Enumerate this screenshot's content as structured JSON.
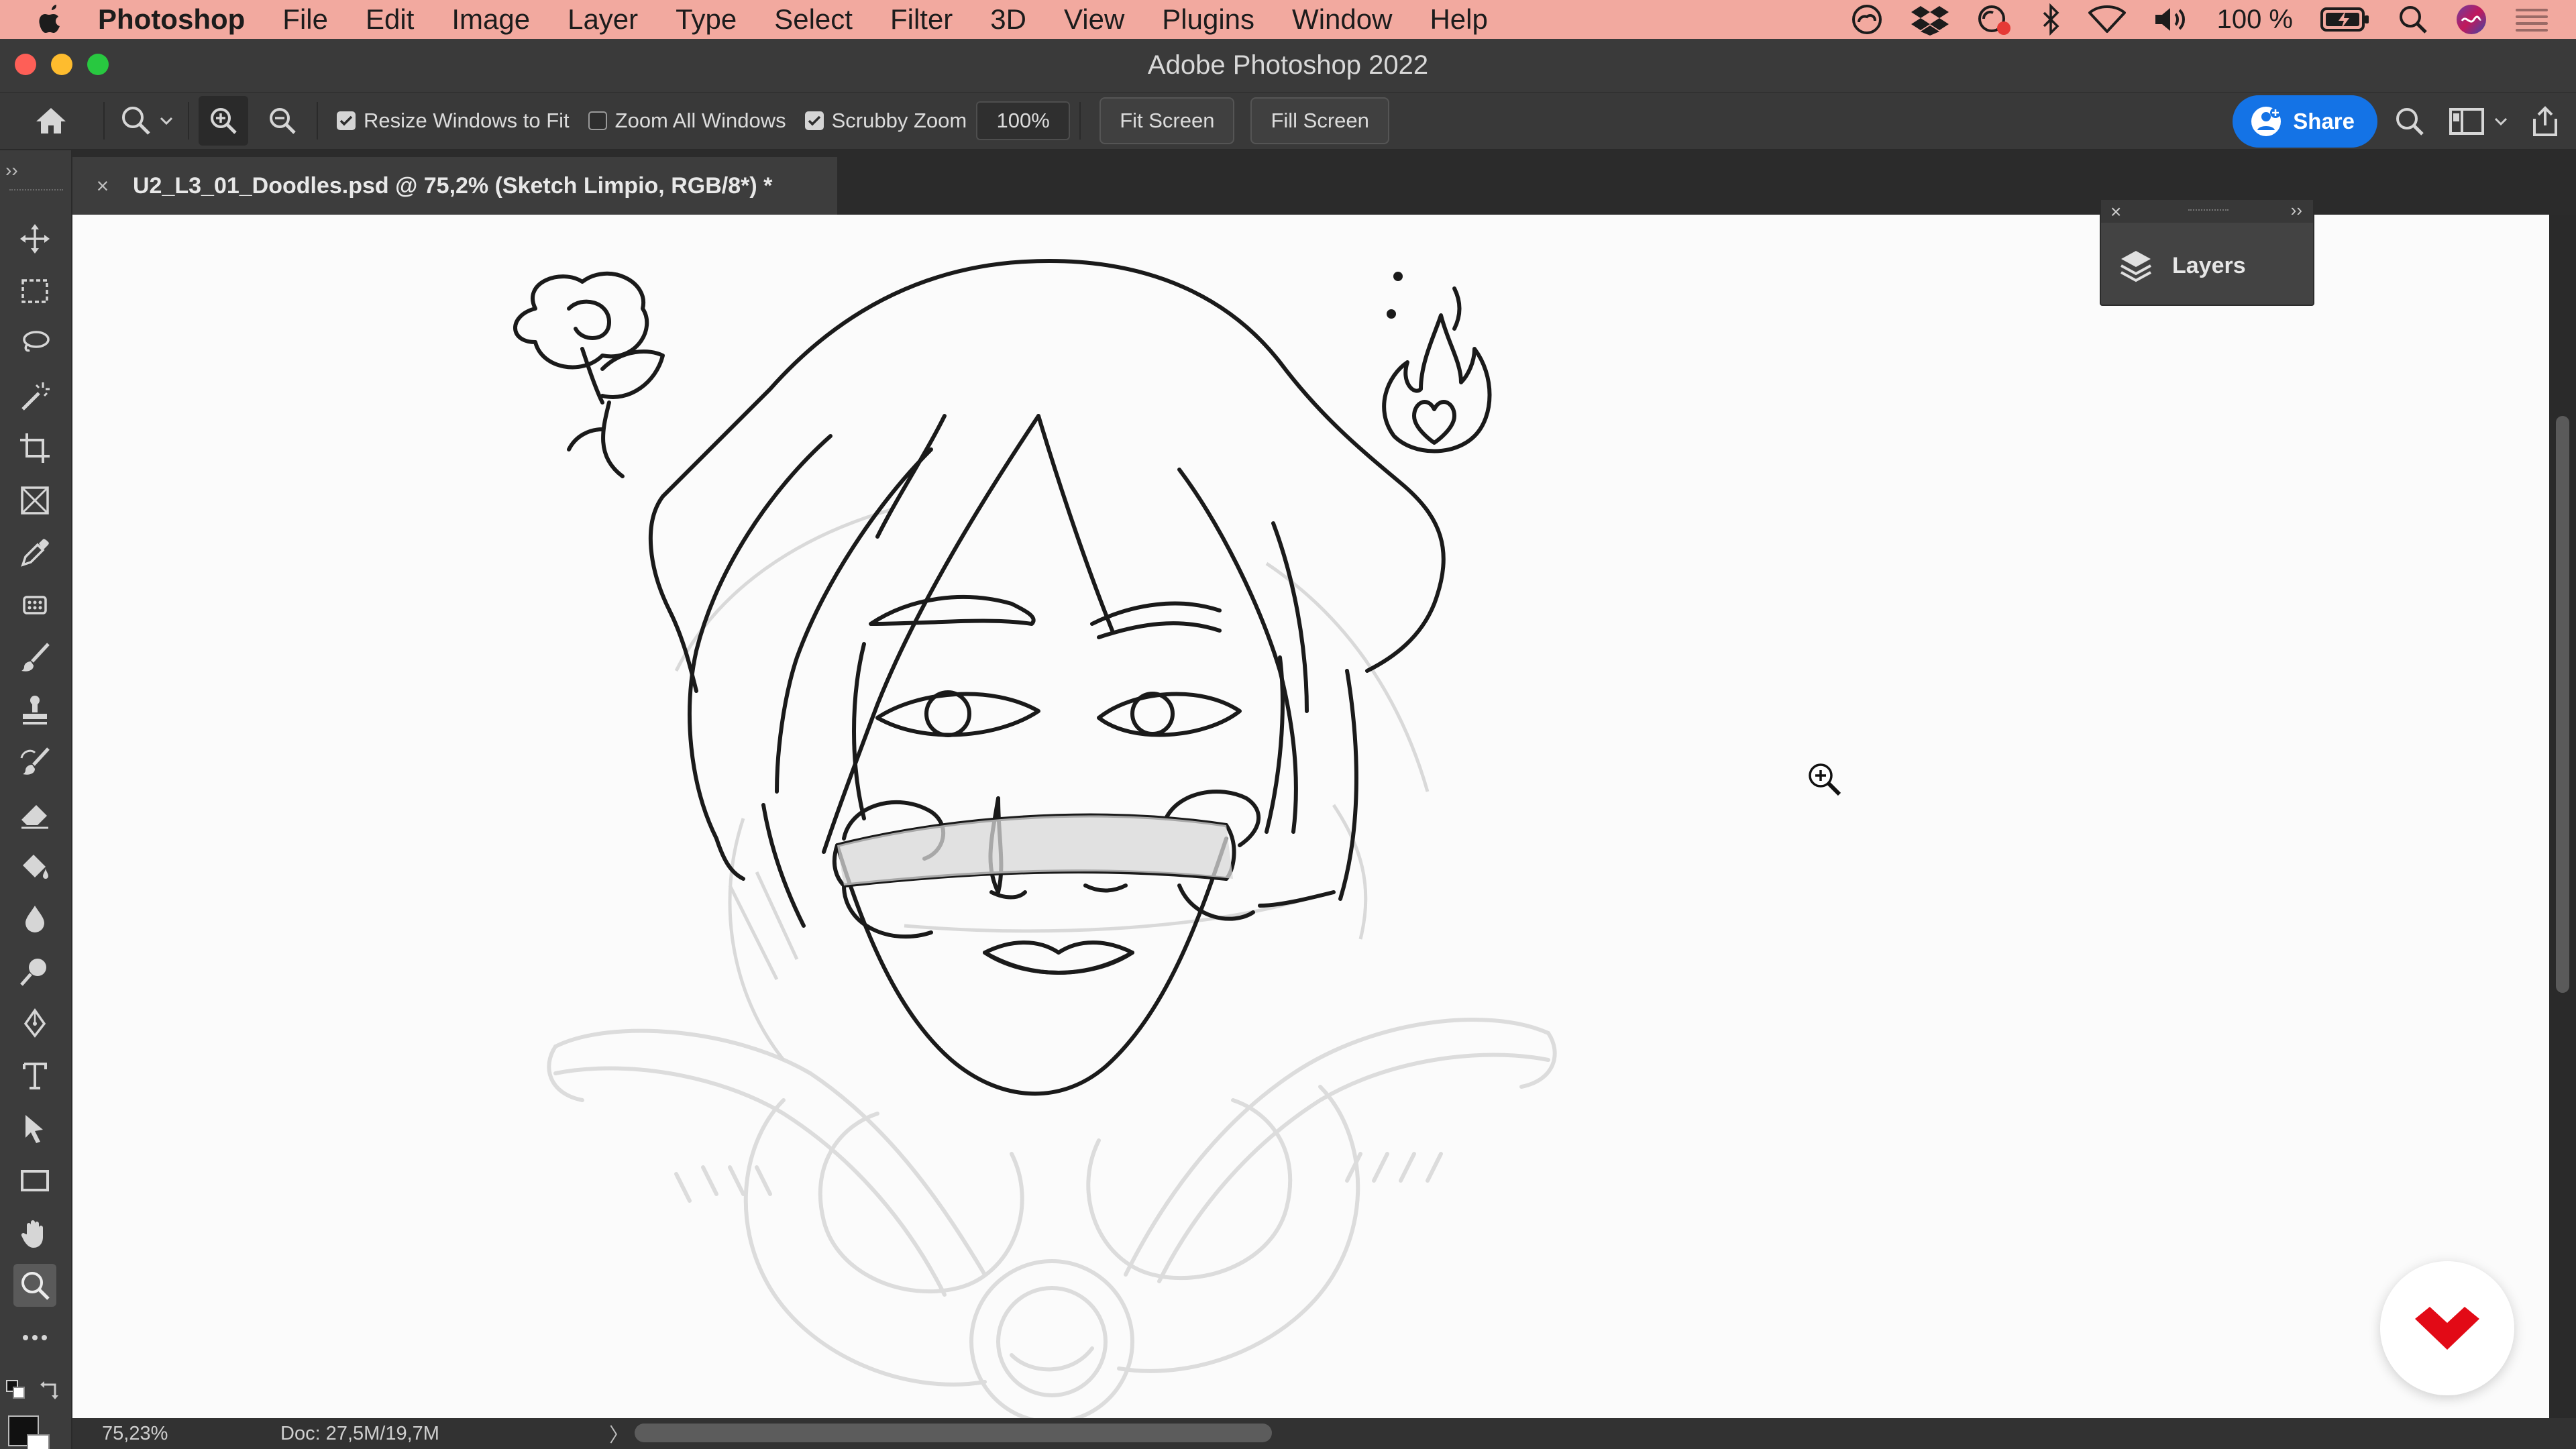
{
  "menubar": {
    "app_name": "Photoshop",
    "items": [
      "File",
      "Edit",
      "Image",
      "Layer",
      "Type",
      "Select",
      "Filter",
      "3D",
      "View",
      "Plugins",
      "Window",
      "Help"
    ],
    "battery": "100 %"
  },
  "window": {
    "title": "Adobe Photoshop 2022"
  },
  "options": {
    "resize_windows": {
      "label": "Resize Windows to Fit",
      "checked": true
    },
    "zoom_all": {
      "label": "Zoom All Windows",
      "checked": false
    },
    "scrubby_zoom": {
      "label": "Scrubby Zoom",
      "checked": true
    },
    "zoom_value": "100%",
    "fit_screen": "Fit Screen",
    "fill_screen": "Fill Screen",
    "share": "Share"
  },
  "document": {
    "tab_close": "×",
    "tab_label": "U2_L3_01_Doodles.psd @ 75,2% (Sketch Limpio, RGB/8*) *"
  },
  "panel": {
    "layers_label": "Layers",
    "close": "×",
    "expand": "››"
  },
  "statusbar": {
    "zoom": "75,23%",
    "doc_size": "Doc: 27,5M/19,7M",
    "arrow": "〉"
  },
  "tools": [
    "move",
    "marquee",
    "lasso",
    "magic-wand",
    "crop",
    "frame",
    "eyedropper",
    "patch",
    "brush",
    "clone-stamp",
    "history-brush",
    "eraser",
    "paint-bucket",
    "blur",
    "dodge",
    "pen",
    "type",
    "path-selection",
    "rectangle",
    "hand",
    "zoom",
    "more"
  ],
  "colors": {
    "menubar": "#f2a99f",
    "share_button": "#1473e6",
    "brand": "#e20a16",
    "foreground": "#111111",
    "background": "#ffffff"
  }
}
